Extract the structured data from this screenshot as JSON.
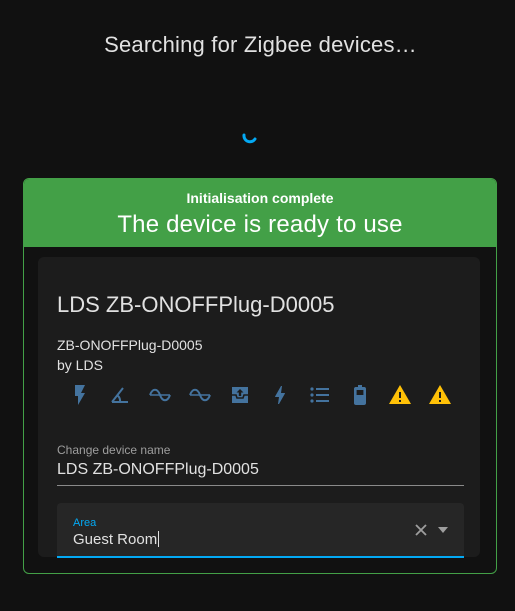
{
  "page": {
    "title": "Searching for Zigbee devices…"
  },
  "status": {
    "subtitle": "Initialisation complete",
    "headline": "The device is ready to use"
  },
  "device": {
    "name": "LDS ZB-ONOFFPlug-D0005",
    "model": "ZB-ONOFFPlug-D0005",
    "manufacturer": "by LDS"
  },
  "entity_icons": [
    "flash-icon",
    "angle-acute-icon",
    "sine-wave-icon",
    "sine-wave-icon",
    "home-import-icon",
    "lightning-bolt-icon",
    "format-list-bulleted-icon",
    "battery-icon",
    "alert-icon",
    "alert-icon"
  ],
  "name_field": {
    "label": "Change device name",
    "value": "LDS ZB-ONOFFPlug-D0005"
  },
  "area_field": {
    "label": "Area",
    "value": "Guest Room"
  },
  "colors": {
    "success": "#43a047",
    "accent": "#03a9f4",
    "icon": "#44739e",
    "warning": "#ffc107",
    "background": "#111111",
    "panel": "#1c1c1c"
  }
}
